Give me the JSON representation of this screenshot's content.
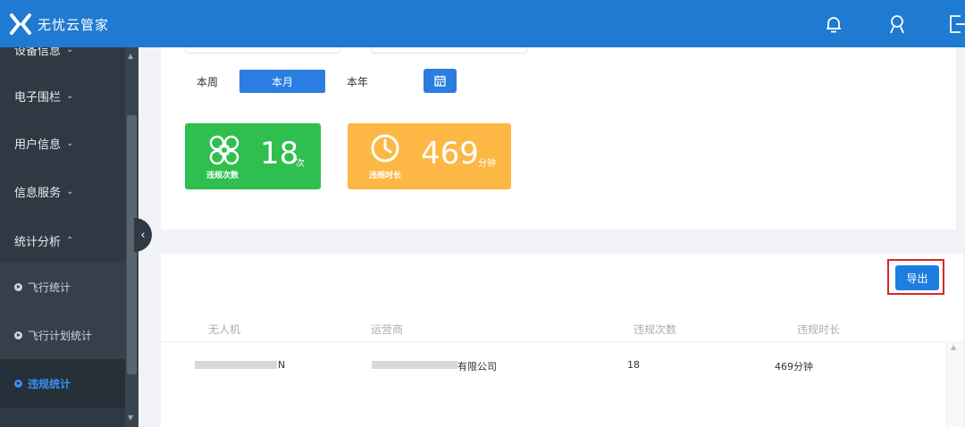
{
  "app": {
    "title": "无忧云管家",
    "brand_color": "#1f7ad1"
  },
  "header_icons": [
    "bell-icon",
    "user-icon",
    "logout-icon"
  ],
  "sidebar": {
    "partial_top_label": "设备信息",
    "items": [
      {
        "label": "电子围栏",
        "chevron": "⌄"
      },
      {
        "label": "用户信息",
        "chevron": "⌄"
      },
      {
        "label": "信息服务",
        "chevron": "⌄"
      },
      {
        "label": "统计分析",
        "chevron": "⌃"
      }
    ],
    "subitems": [
      {
        "label": "飞行统计",
        "active": false
      },
      {
        "label": "飞行计划统计",
        "active": false
      },
      {
        "label": "违规统计",
        "active": true
      }
    ]
  },
  "filters": {
    "period_buttons": [
      {
        "label": "本周",
        "active": false
      },
      {
        "label": "本月",
        "active": true
      },
      {
        "label": "本年",
        "active": false
      }
    ],
    "calendar_icon": "calendar-icon"
  },
  "stats": {
    "violation_count": {
      "value": "18",
      "unit": "次",
      "caption": "违规次数",
      "color": "#2fbf4f",
      "icon": "drone-icon"
    },
    "violation_duration": {
      "value": "469",
      "unit": "分钟",
      "caption": "违规时长",
      "color": "#fdb745",
      "icon": "clock-icon"
    }
  },
  "table": {
    "export_label": "导出",
    "columns": [
      "无人机",
      "运营商",
      "违规次数",
      "违规时长"
    ],
    "rows": [
      {
        "drone_visible": "N",
        "operator_visible": "有限公司",
        "count": "18",
        "duration": "469分钟"
      }
    ]
  }
}
